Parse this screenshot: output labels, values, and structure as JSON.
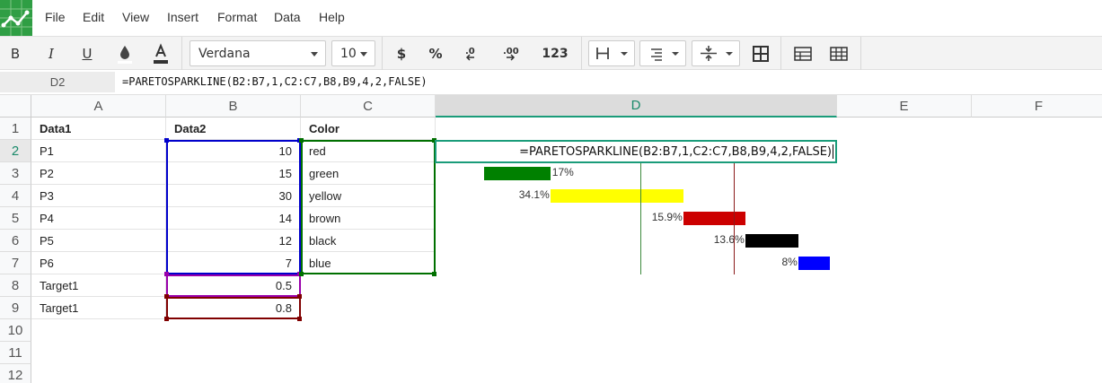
{
  "menu": {
    "items": [
      "File",
      "Edit",
      "View",
      "Insert",
      "Format",
      "Data",
      "Help"
    ]
  },
  "toolbar": {
    "bold_label": "B",
    "italic_label": "I",
    "underline_label": "U",
    "font_family": "Verdana",
    "font_size": "10",
    "currency_label": "$",
    "percent_label": "%",
    "decrease_decimals_label": ".0",
    "increase_decimals_label": ".00",
    "more_formats_label": "123"
  },
  "formula_bar": {
    "cell_ref": "D2",
    "formula": "=PARETOSPARKLINE(B2:B7,1,C2:C7,B8,B9,4,2,FALSE)"
  },
  "columns": [
    "A",
    "B",
    "C",
    "D",
    "E",
    "F"
  ],
  "active_column": "D",
  "rows": [
    "1",
    "2",
    "3",
    "4",
    "5",
    "6",
    "7",
    "8",
    "9",
    "10",
    "11",
    "12"
  ],
  "active_row": "2",
  "cells": {
    "A": [
      "Data1",
      "P1",
      "P2",
      "P3",
      "P4",
      "P5",
      "P6",
      "Target1",
      "Target1"
    ],
    "B": [
      "Data2",
      "10",
      "15",
      "30",
      "14",
      "12",
      "7",
      "0.5",
      "0.8"
    ],
    "C": [
      "Color",
      "red",
      "green",
      "yellow",
      "brown",
      "black",
      "blue"
    ]
  },
  "editor": {
    "text": "=PARETOSPARKLINE(B2:B7,1,C2:C7,B8,B9,4,2,FALSE)"
  },
  "sparkline": {
    "segments": [
      {
        "label": "17%",
        "percent": 17,
        "color": "#008000"
      },
      {
        "label": "34.1%",
        "percent": 34.1,
        "color": "#ffff00"
      },
      {
        "label": "15.9%",
        "percent": 15.9,
        "color": "#cc0000"
      },
      {
        "label": "13.6%",
        "percent": 13.6,
        "color": "#000000"
      },
      {
        "label": "8%",
        "percent": 8,
        "color": "#0000ff"
      }
    ],
    "target1": 0.5,
    "target2": 0.8,
    "target1_color": "#3d8a3d",
    "target2_color": "#8b1a1a"
  },
  "colors": {
    "accent": "#1a9c7a",
    "logo": "#2f9e44",
    "range_b": "#0000cc",
    "range_c": "#007000",
    "range_b8": "#9900aa",
    "range_b9": "#800000"
  }
}
